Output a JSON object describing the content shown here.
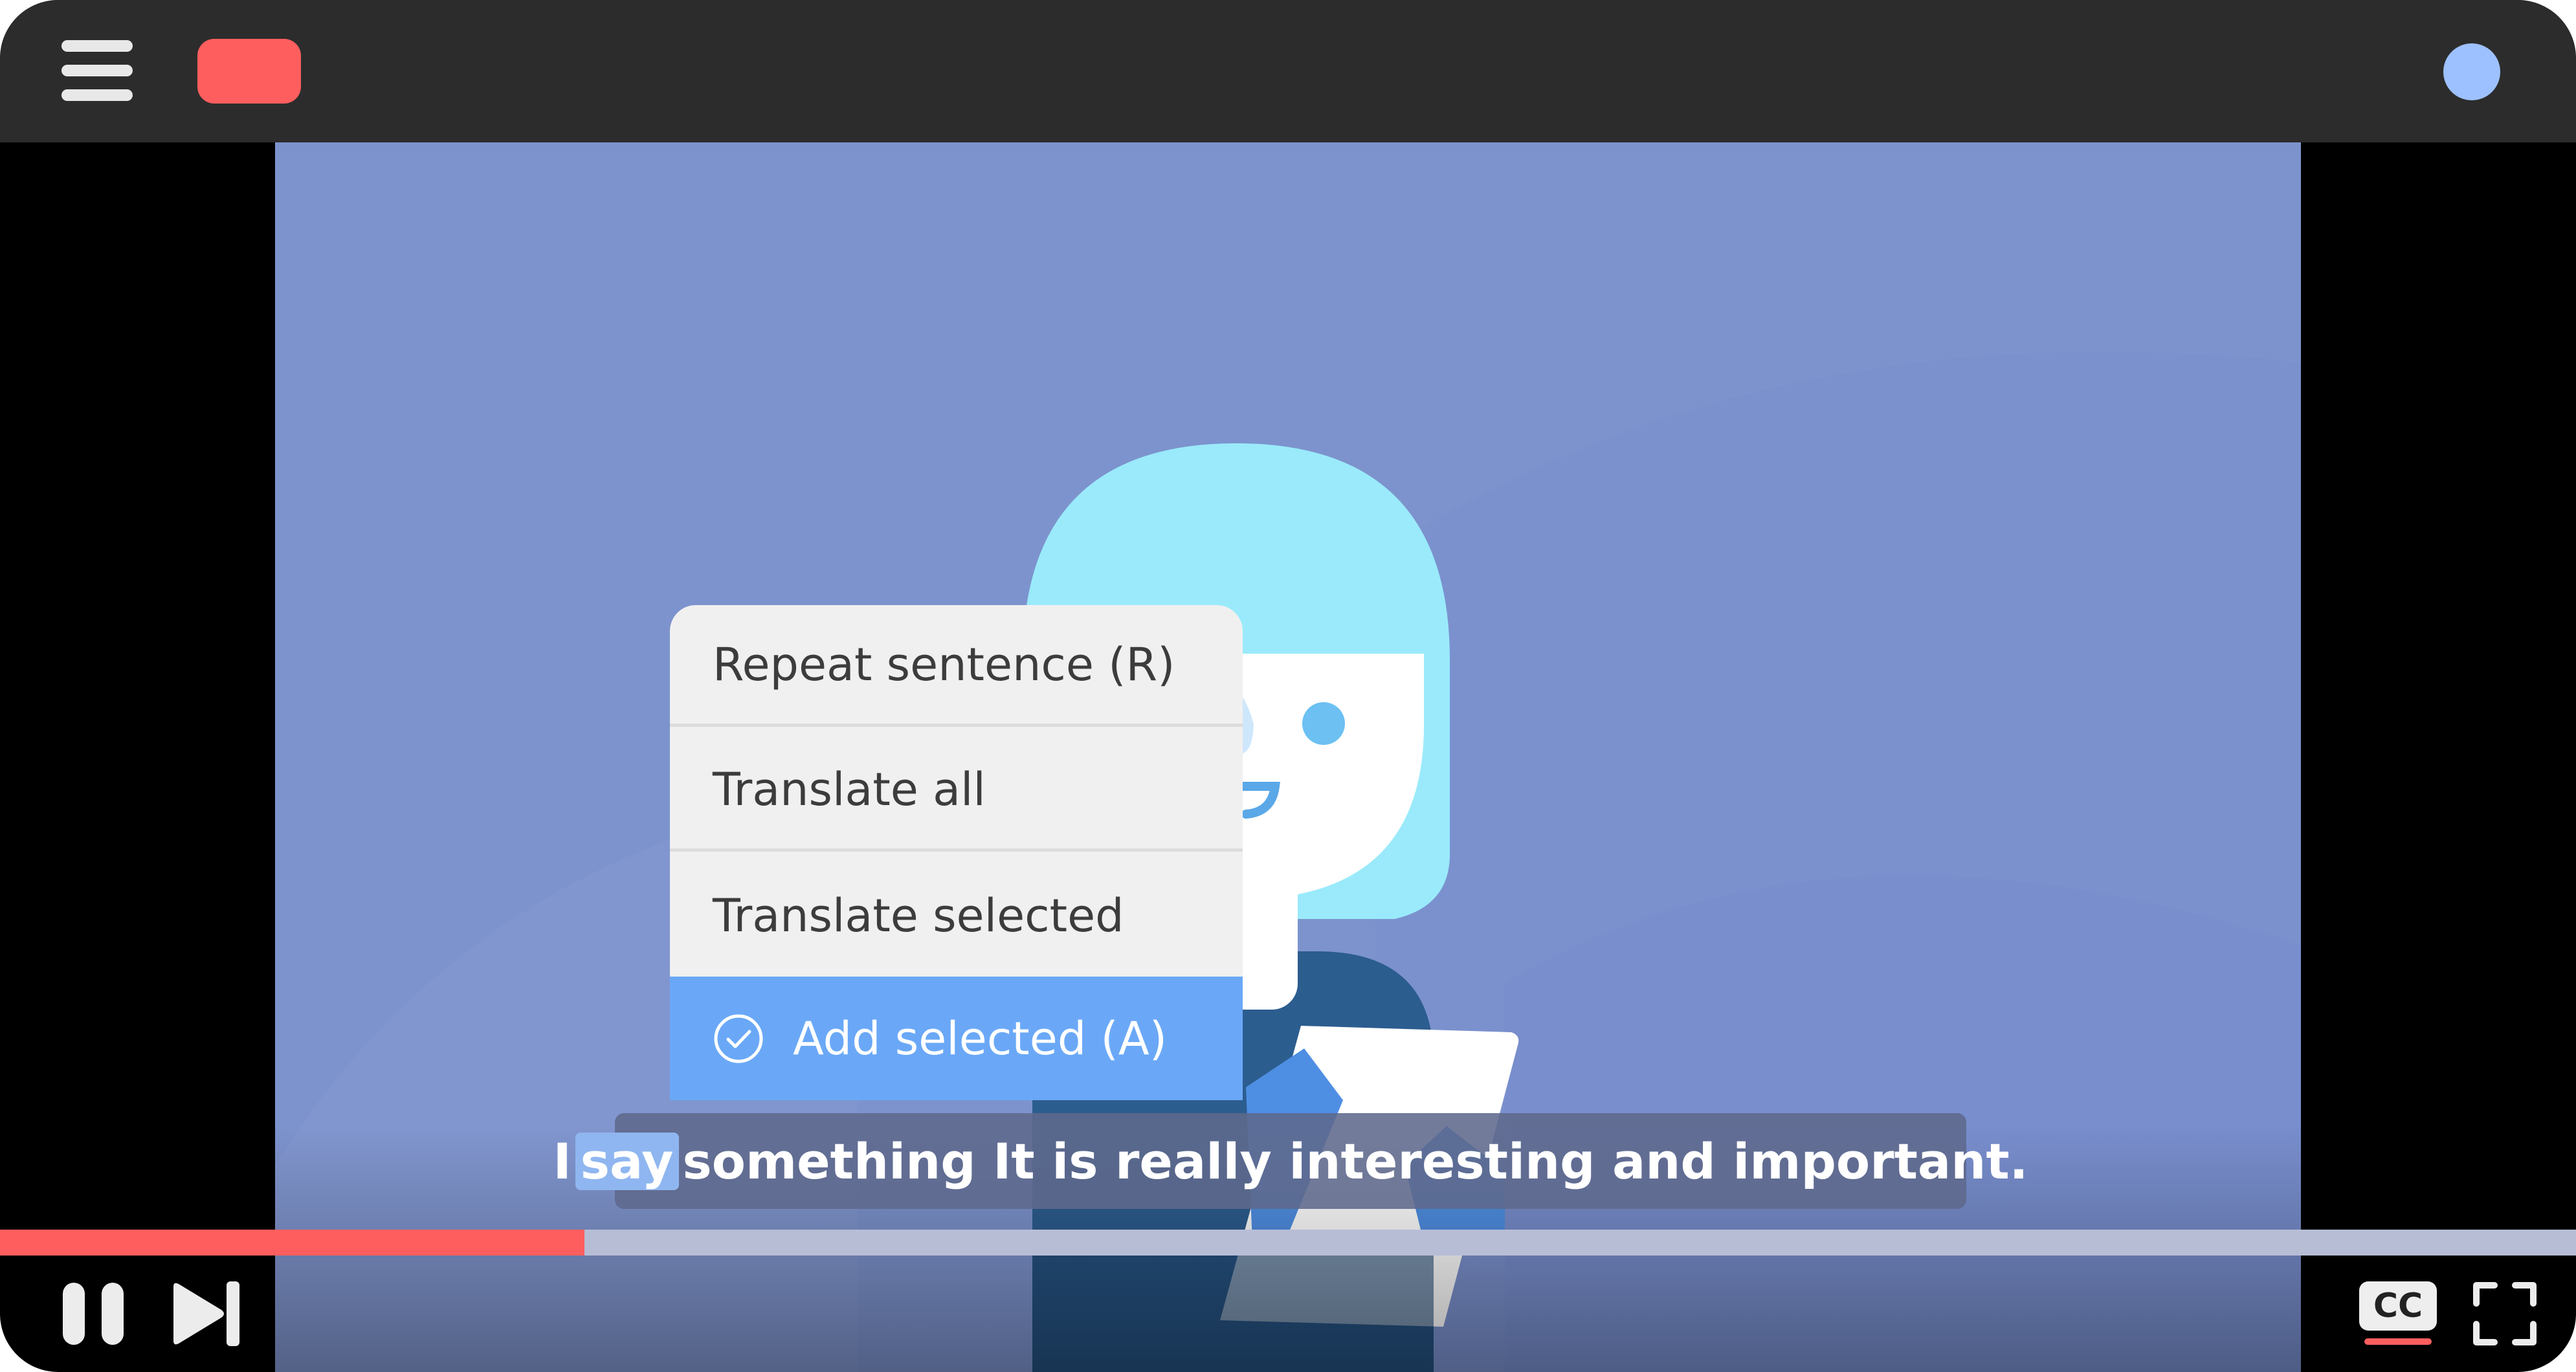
{
  "colors": {
    "topbar": "#2c2c2c",
    "logo_badge": "#ff5e5e",
    "avatar": "#9dc1ff",
    "video_bg": "#7d93cd",
    "menu_bg": "#f0f0f0",
    "menu_selected": "#6aa8f7",
    "progress_played": "#ff5e5e",
    "progress_rest": "#b8bdd6",
    "cc_bg": "#eeeeee",
    "cc_underline": "#ff5e5e"
  },
  "context_menu": {
    "items": [
      {
        "label": "Repeat sentence (R)",
        "selected": false
      },
      {
        "label": "Translate all",
        "selected": false
      },
      {
        "label": "Translate selected",
        "selected": false
      },
      {
        "label": "Add selected (A)",
        "selected": true,
        "icon": "check-circle-icon"
      }
    ]
  },
  "subtitle": {
    "before": "I",
    "highlight": "say",
    "after": "something It is really interesting and important."
  },
  "player": {
    "progress_fraction": 0.227,
    "cc_label": "CC",
    "controls": {
      "pause_icon": "pause-icon",
      "next_icon": "skip-next-icon",
      "fullscreen_icon": "fullscreen-icon",
      "menu_icon": "hamburger-menu-icon"
    }
  }
}
